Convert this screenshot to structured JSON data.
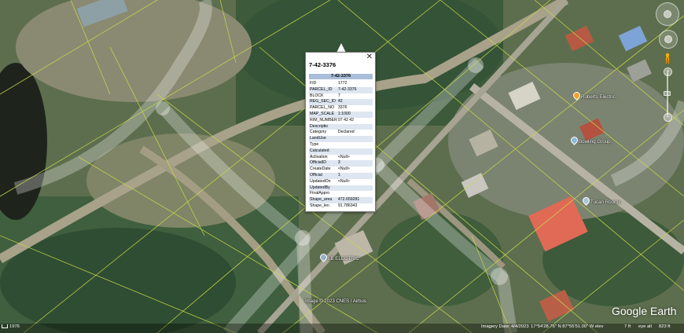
{
  "popup": {
    "title": "7-42-3376",
    "header": "7-42-3376",
    "close_glyph": "✕",
    "rows": [
      {
        "k": "FID",
        "v": "1772"
      },
      {
        "k": "PARCEL_ID",
        "v": "7-42-3376"
      },
      {
        "k": "BLOCK",
        "v": "7"
      },
      {
        "k": "REG_SEC_ID",
        "v": "42"
      },
      {
        "k": "PARCEL_NO",
        "v": "3376"
      },
      {
        "k": "MAP_SCALE",
        "v": "1:1000"
      },
      {
        "k": "RIM_NUMBER",
        "v": "07 42 42"
      },
      {
        "k": "Descriptio",
        "v": ""
      },
      {
        "k": "Category",
        "v": "Declared"
      },
      {
        "k": "LandUse",
        "v": ""
      },
      {
        "k": "Type",
        "v": ""
      },
      {
        "k": "Calculated",
        "v": ""
      },
      {
        "k": "Activation",
        "v": "<Null>"
      },
      {
        "k": "OfficialID",
        "v": "3"
      },
      {
        "k": "CreateDate",
        "v": "<Null>"
      },
      {
        "k": "Official",
        "v": "1"
      },
      {
        "k": "UpdatedOn",
        "v": "<Null>"
      },
      {
        "k": "UpdatedBy",
        "v": ""
      },
      {
        "k": "FinalAppro",
        "v": ""
      },
      {
        "k": "Shape_area",
        "v": "472.659281"
      },
      {
        "k": "Shape_len",
        "v": "91.786343"
      }
    ]
  },
  "places": [
    {
      "label": "LB ELECTRIC",
      "color": "#9ab0c8"
    },
    {
      "label": "Bowling Group",
      "color": "#8fb8d8"
    },
    {
      "label": "Tucan Rooms",
      "color": "#b0c4d8"
    },
    {
      "label": "Roberts Electric",
      "color": "#f0a030"
    }
  ],
  "bottom": {
    "copyright": "Image © 2023 CNES / Airbus",
    "left_counter": "1976",
    "imagery_date": "Imagery Date: 4/4/2023",
    "coords": "17°54'28.76\" N   87°55'51.00\" W   elev",
    "elev_value": "7 ft",
    "eye_alt_label": "eye alt",
    "eye_alt_value": "823 ft"
  },
  "logo": "Google Earth",
  "accent_colors": {
    "popup_header": "#a9bed9",
    "popup_alt_row": "#dde6f1",
    "parcel_lines": "#c9d84a"
  }
}
